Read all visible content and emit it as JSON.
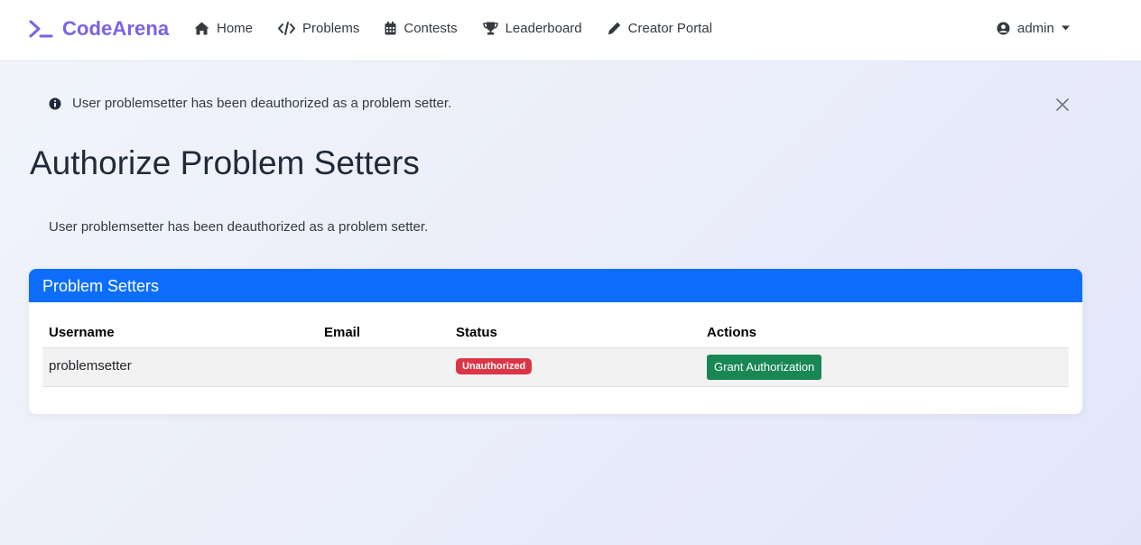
{
  "navbar": {
    "brand": "CodeArena",
    "brand_color": "#7b61e8",
    "links": [
      {
        "label": "Home",
        "icon": "home-icon"
      },
      {
        "label": "Problems",
        "icon": "code-icon"
      },
      {
        "label": "Contests",
        "icon": "calendar-icon"
      },
      {
        "label": "Leaderboard",
        "icon": "trophy-icon"
      },
      {
        "label": "Creator Portal",
        "icon": "pencil-icon"
      }
    ],
    "user": {
      "name": "admin",
      "icon": "user-circle-icon"
    }
  },
  "alert": {
    "text": "User problemsetter has been deauthorized as a problem setter.",
    "icon": "info-circle-icon"
  },
  "page": {
    "title": "Authorize Problem Setters",
    "message": "User problemsetter has been deauthorized as a problem setter."
  },
  "card": {
    "header": "Problem Setters",
    "header_color": "#0d6efd",
    "columns": [
      "Username",
      "Email",
      "Status",
      "Actions"
    ],
    "rows": [
      {
        "username": "problemsetter",
        "email": "",
        "status": "Unauthorized",
        "status_color": "#dc3545",
        "action": "Grant Authorization",
        "action_color": "#198754"
      }
    ]
  }
}
